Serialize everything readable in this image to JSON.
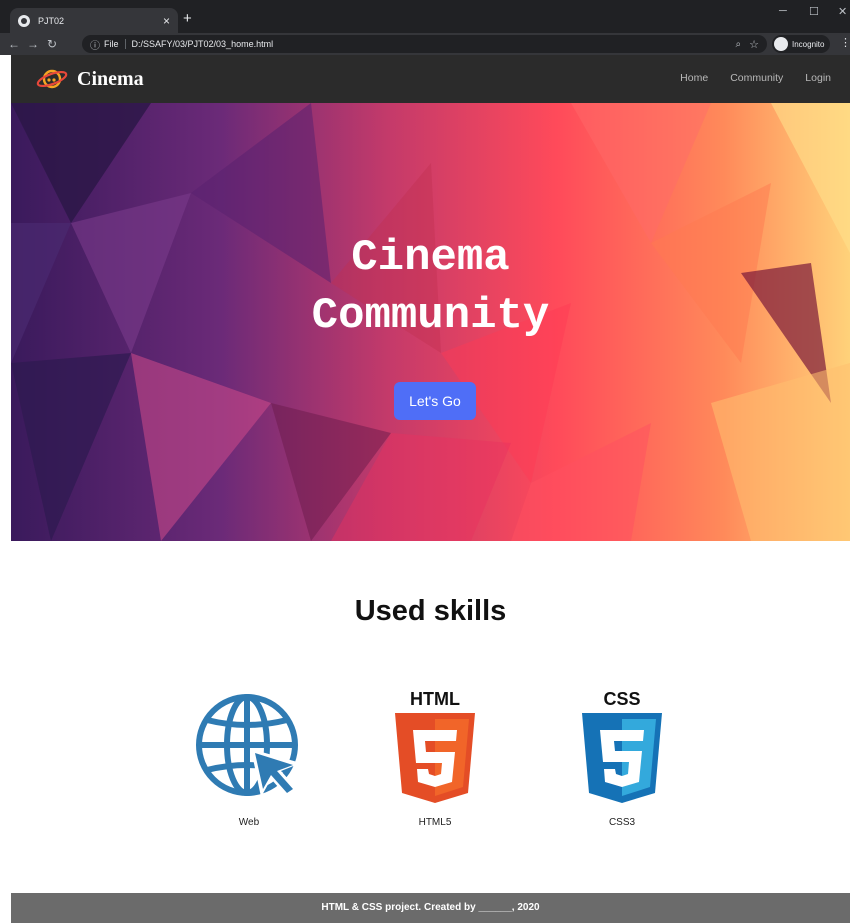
{
  "browser": {
    "tab_title": "PJT02",
    "tab_close": "×",
    "new_tab": "+",
    "url_scheme_label": "File",
    "url": "D:/SSAFY/03/PJT02/03_home.html",
    "incognito_label": "Incognito"
  },
  "navbar": {
    "brand": "Cinema",
    "links": [
      "Home",
      "Community",
      "Login"
    ]
  },
  "hero": {
    "title_line1": "Cinema",
    "title_line2": "Community",
    "cta": "Let's Go"
  },
  "skills": {
    "title": "Used skills",
    "items": [
      {
        "label": "Web",
        "icon": "globe-cursor-icon"
      },
      {
        "label": "HTML5",
        "icon": "html5-icon",
        "badge": "HTML"
      },
      {
        "label": "CSS3",
        "icon": "css3-icon",
        "badge": "CSS"
      }
    ]
  },
  "footer": {
    "text": "HTML & CSS project. Created by ______, 2020"
  },
  "colors": {
    "navbar": "#2b2b2b",
    "cta": "#4f6ef7",
    "footer": "#6b6b6b",
    "web_icon": "#2f7bb3",
    "html5": "#e44d26",
    "css3": "#1572b6"
  }
}
